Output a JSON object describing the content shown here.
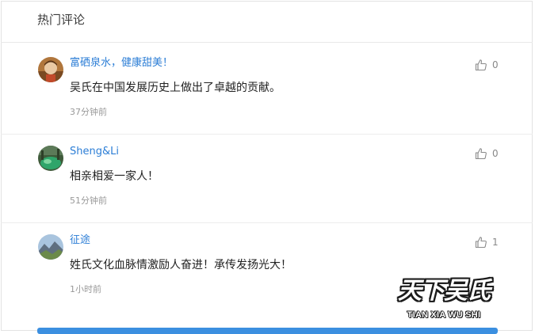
{
  "header": {
    "title": "热门评论"
  },
  "comments": [
    {
      "username": "富硒泉水，健康甜美！",
      "content": "吴氏在中国发展历史上做出了卓越的贡献。",
      "time": "37分钟前",
      "likes": "0",
      "avatar_icon": "person-portrait-avatar"
    },
    {
      "username": "Sheng&Li",
      "content": "相亲相爱一家人！",
      "time": "51分钟前",
      "likes": "0",
      "avatar_icon": "landscape-photo-avatar"
    },
    {
      "username": "征途",
      "content": "姓氏文化血脉情激励人奋进！承传发扬光大！",
      "time": "1小时前",
      "likes": "1",
      "avatar_icon": "mountain-photo-avatar"
    }
  ],
  "watermark": {
    "title": "天下吴氏",
    "subtitle": "TIAN XIA WU SHI"
  },
  "colors": {
    "username": "#2c7ed6",
    "accent_bar": "#3b8fe0",
    "muted": "#999999"
  }
}
